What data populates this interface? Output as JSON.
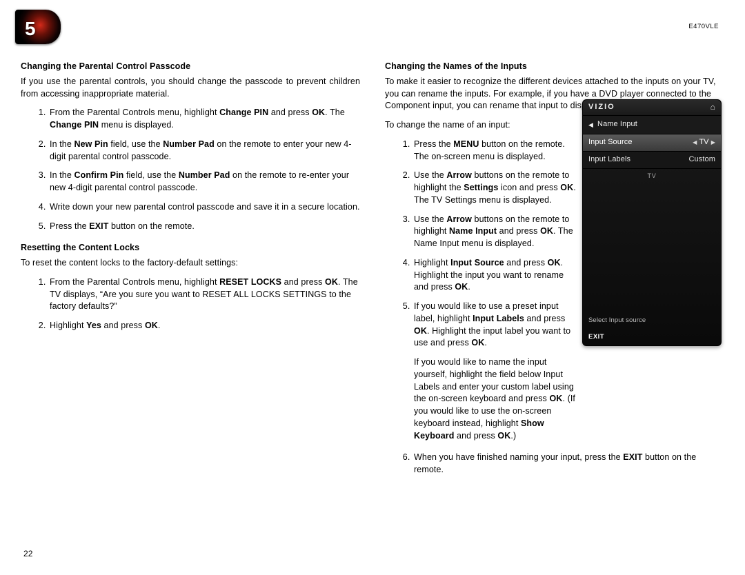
{
  "meta": {
    "model": "E470VLE",
    "chapter": "5",
    "page": "22"
  },
  "left": {
    "s1_title": "Changing the Parental Control Passcode",
    "s1_intro": "If you use the parental controls, you should change the passcode to prevent children from accessing inappropriate material.",
    "s1_li1": "From the Parental Controls menu, highlight <b>Change PIN</b> and press <b>OK</b>. The <b>Change PIN</b> menu is displayed.",
    "s1_li2": "In the <b>New Pin</b> field, use the <b>Number Pad</b> on the remote to enter your new 4-digit parental control passcode.",
    "s1_li3": "In the <b>Confirm Pin</b> field, use the <b>Number Pad</b> on the remote to re-enter your new 4-digit parental control passcode.",
    "s1_li4": "Write down your new parental control passcode and save it in a secure location.",
    "s1_li5": "Press the <b>EXIT</b> button on the remote.",
    "s2_title": "Resetting the Content Locks",
    "s2_intro": "To reset the content locks to the factory-default settings:",
    "s2_li1": "From the Parental Controls menu, highlight <b>RESET LOCKS</b> and press <b>OK</b>. The TV displays, “Are you sure you want to RESET ALL LOCKS SETTINGS to the factory defaults?”",
    "s2_li2": "Highlight <b>Yes</b> and press <b>OK</b>."
  },
  "right": {
    "s1_title": "Changing the Names of the Inputs",
    "s1_intro": "To make it easier to recognize the different devices attached to the inputs on your TV, you can rename the inputs. For example, if you have a DVD player connected to the Component input, you can rename that input to display “DVD Player”.",
    "s1_lead": "To change the name of an input:",
    "s1_li1": "Press the <b>MENU</b> button on the remote. The on-screen menu is displayed.",
    "s1_li2": "Use the <b>Arrow</b> buttons on the remote to highlight the <b>Settings</b> icon and press <b>OK</b>. The TV Settings menu is displayed.",
    "s1_li3": "Use the <b>Arrow</b> buttons on the remote to highlight <b>Name Input</b> and press <b>OK</b>. The Name Input menu is displayed.",
    "s1_li4": "Highlight <b>Input Source</b> and press <b>OK</b>. Highlight the input you want to rename and press <b>OK</b>.",
    "s1_li5": "If you would like to use a preset input label, highlight <b>Input Labels</b> and press <b>OK</b>. Highlight the input label you want to use and press <b>OK</b>.",
    "s1_li5b": "If you would like to name the input yourself, highlight the field below Input Labels and enter your custom label using the on-screen keyboard and press <b>OK</b>. (If you would like to use the on-screen keyboard instead, highlight <b>Show Keyboard</b> and press <b>OK</b>.)",
    "s1_li6": "When you have finished naming your input, press the <b>EXIT</b> button on the remote."
  },
  "osd": {
    "logo": "VIZIO",
    "back_label": "Name Input",
    "row1_label": "Input Source",
    "row1_value": "TV",
    "row2_label": "Input Labels",
    "row2_value": "Custom",
    "section": "TV",
    "hint": "Select Input source",
    "exit": "EXIT"
  }
}
